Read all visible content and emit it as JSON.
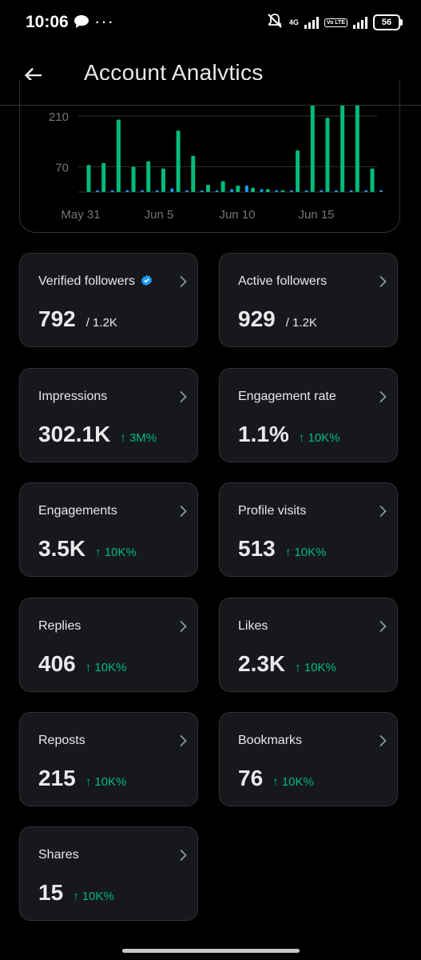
{
  "status_bar": {
    "time": "10:06",
    "dots": "···",
    "network_1": "4G",
    "volte": "Vo LTE",
    "battery": "56"
  },
  "header": {
    "back_icon": "arrow-left-icon",
    "title": "Account Analytics"
  },
  "chart_data": {
    "type": "bar",
    "y_ticks": [
      "210",
      "70"
    ],
    "x_ticks": [
      "May 31",
      "Jun 5",
      "Jun 10",
      "Jun 15"
    ],
    "series": [
      {
        "color": "#00ba7c",
        "values": [
          75,
          80,
          200,
          70,
          85,
          65,
          170,
          100,
          20,
          30,
          18,
          12,
          8,
          5,
          115,
          245,
          205,
          240,
          285,
          65
        ]
      },
      {
        "color": "#1d9bf0",
        "values": [
          3,
          3,
          5,
          3,
          3,
          10,
          3,
          3,
          3,
          8,
          18,
          8,
          5,
          3,
          3,
          5,
          3,
          3,
          3,
          3
        ]
      }
    ],
    "ylim": [
      0,
      300
    ]
  },
  "cards": [
    {
      "label": "Verified followers",
      "value": "792",
      "sub": "/ 1.2K",
      "verified": true
    },
    {
      "label": "Active followers",
      "value": "929",
      "sub": "/ 1.2K"
    },
    {
      "label": "Impressions",
      "value": "302.1K",
      "change": "↑ 3M%"
    },
    {
      "label": "Engagement rate",
      "value": "1.1%",
      "change": "↑ 10K%"
    },
    {
      "label": "Engagements",
      "value": "3.5K",
      "change": "↑ 10K%"
    },
    {
      "label": "Profile visits",
      "value": "513",
      "change": "↑ 10K%"
    },
    {
      "label": "Replies",
      "value": "406",
      "change": "↑ 10K%"
    },
    {
      "label": "Likes",
      "value": "2.3K",
      "change": "↑ 10K%"
    },
    {
      "label": "Reposts",
      "value": "215",
      "change": "↑ 10K%"
    },
    {
      "label": "Bookmarks",
      "value": "76",
      "change": "↑ 10K%"
    },
    {
      "label": "Shares",
      "value": "15",
      "change": "↑ 10K%"
    }
  ],
  "colors": {
    "background": "#000000",
    "card": "#16181c",
    "border": "#2f3336",
    "accent_green": "#00ba7c",
    "accent_blue": "#1d9bf0"
  }
}
